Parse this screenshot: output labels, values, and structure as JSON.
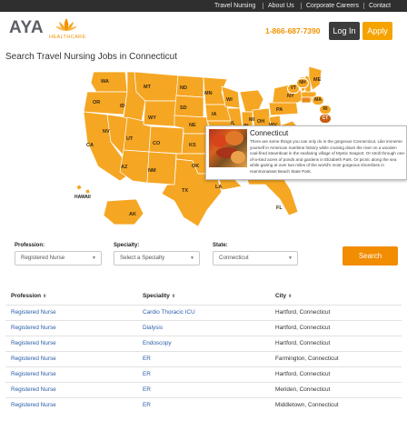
{
  "nav": {
    "links": [
      "Travel Nursing",
      "About Us",
      "Corporate Careers",
      "Contact"
    ]
  },
  "header": {
    "logo_text": "AYA",
    "logo_sub": "HEALTHCARE",
    "phone": "1-866-687-7390",
    "login_label": "Log In",
    "apply_label": "Apply"
  },
  "page": {
    "title": "Search Travel Nursing Jobs in Connecticut"
  },
  "map": {
    "state_labels": [
      "WA",
      "OR",
      "CA",
      "NV",
      "ID",
      "MT",
      "WY",
      "UT",
      "AZ",
      "CO",
      "NM",
      "ND",
      "SD",
      "NE",
      "KS",
      "OK",
      "TX",
      "MN",
      "IA",
      "MO",
      "AR",
      "LA",
      "WI",
      "IL",
      "MI",
      "IN",
      "OH",
      "KY",
      "TN",
      "MS",
      "AL",
      "GA",
      "FL",
      "SC",
      "NC",
      "VA",
      "WV",
      "PA",
      "NY",
      "ME",
      "VT",
      "NH",
      "MA",
      "RI",
      "CT",
      "AK",
      "HAWAII"
    ],
    "selected_state": "CT"
  },
  "popup": {
    "title": "Connecticut",
    "body": "There are some things you can only do in the gorgeous Connecticut. Like immerse yourself in American maritime history while cruising down the river on a wooden coal-fired steamboat in the seafaring village of Mystic Seaport. Or stroll through one-of-a-kind acres of ponds and gardens in Elizabeth Park. Or picnic along the sea while gazing at over two miles of the world's most gorgeous shorelines in Hammonasset Beach State Park."
  },
  "filters": {
    "profession_label": "Profession:",
    "profession_value": "Registered Nurse",
    "specialty_label": "Specialty:",
    "specialty_value": "Select a Specialty",
    "state_label": "State:",
    "state_value": "Connecticut",
    "search_label": "Search"
  },
  "table": {
    "headers": [
      "Profession",
      "Speciality",
      "City"
    ],
    "rows": [
      [
        "Registered Nurse",
        "Cardio Thoracic ICU",
        "Hartford, Connecticut"
      ],
      [
        "Registered Nurse",
        "Dialysis",
        "Hartford, Connecticut"
      ],
      [
        "Registered Nurse",
        "Endoscopy",
        "Hartford, Connecticut"
      ],
      [
        "Registered Nurse",
        "ER",
        "Farmington, Connecticut"
      ],
      [
        "Registered Nurse",
        "ER",
        "Hartford, Connecticut"
      ],
      [
        "Registered Nurse",
        "ER",
        "Meriden, Connecticut"
      ],
      [
        "Registered Nurse",
        "ER",
        "Middletown, Connecticut"
      ]
    ]
  },
  "colors": {
    "accent": "#f28c00",
    "map_fill": "#f5a623",
    "link": "#2a5ea8",
    "nav_bg": "#2f2f2f"
  }
}
